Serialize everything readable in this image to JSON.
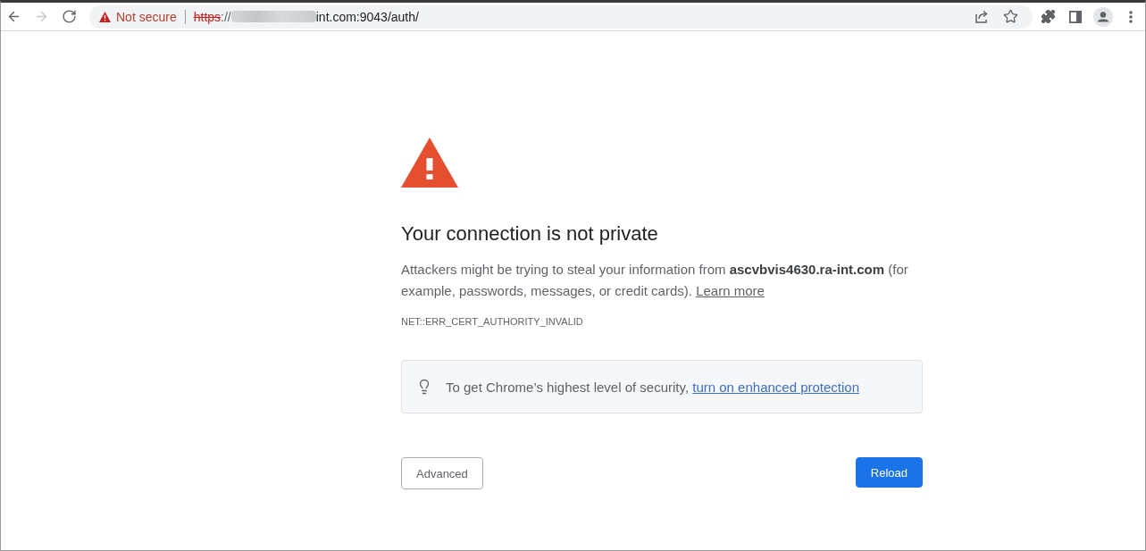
{
  "browser": {
    "nav_buttons": [
      {
        "disabled": false
      },
      {
        "disabled": true
      },
      {
        "disabled": false
      }
    ],
    "address_bar": {
      "security_label": "Not secure",
      "url": {
        "scheme": "https",
        "scheme_struck": true,
        "scheme_suffix": "://",
        "redacted": true,
        "tail": "int.com:9043/auth/"
      }
    }
  },
  "interstitial": {
    "heading": "Your connection is not private",
    "message": "Attackers might be trying to steal your information from **ascvbvis4630.ra-int.com** (for example, passwords, messages, or credit cards).",
    "learn_more_link": "Learn more",
    "error_code": "NET::ERR_CERT_AUTHORITY_INVALID",
    "tip": {
      "text": "To get Chrome’s highest level of security,",
      "link": "turn on enhanced protection"
    },
    "buttons": [
      {
        "kind": "secondary",
        "label": "Advanced"
      },
      {
        "kind": "primary",
        "label": "Reload"
      }
    ]
  }
}
